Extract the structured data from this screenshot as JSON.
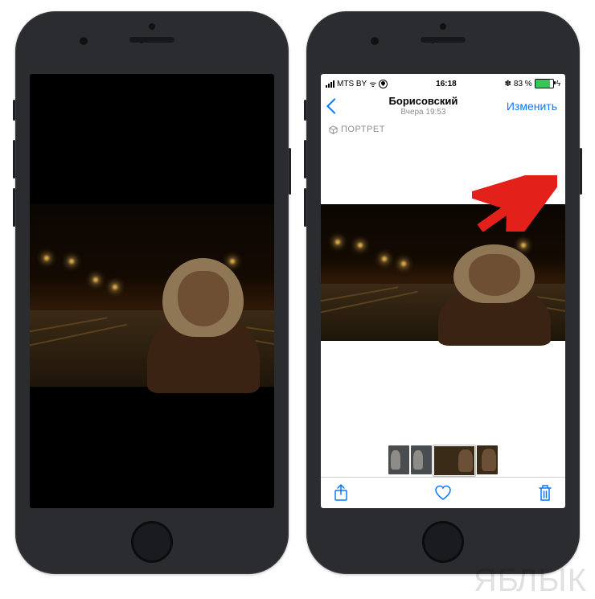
{
  "status_bar": {
    "carrier": "MTS BY",
    "time": "16:18",
    "battery_percent_text": "83 %",
    "battery_fill_percent": 83,
    "bluetooth_glyph": "✽",
    "wifi_glyph": "ᯤ",
    "charge_glyph": "ϟ"
  },
  "nav": {
    "title": "Борисовский",
    "subtitle": "Вчера 19:53",
    "edit_label": "Изменить"
  },
  "badge": {
    "label": "ПОРТРЕТ"
  },
  "colors": {
    "ios_blue": "#0778ff",
    "arrow_red": "#e4201a",
    "battery_green": "#37c759"
  },
  "watermark": {
    "text_before": "ЯБ",
    "apple_glyph": "",
    "text_after": "ЛЫК"
  }
}
